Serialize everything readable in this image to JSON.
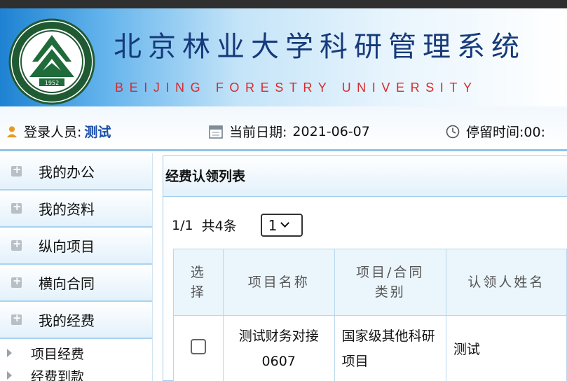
{
  "header": {
    "title": "北京林业大学科研管理系统",
    "subtitle": "BEIJING FORESTRY UNIVERSITY",
    "logo_year": "1952"
  },
  "infobar": {
    "login_label": "登录人员:",
    "login_name": "测试",
    "date_label": "当前日期:",
    "date_value": "2021-06-07",
    "stay_label": "停留时间:00:"
  },
  "sidebar": {
    "menu": [
      {
        "label": "我的办公"
      },
      {
        "label": "我的资料"
      },
      {
        "label": "纵向项目"
      },
      {
        "label": "横向合同"
      },
      {
        "label": "我的经费"
      }
    ],
    "sub_items": [
      {
        "label": "项目经费"
      },
      {
        "label": "经费到款"
      }
    ]
  },
  "main": {
    "panel_title": "经费认领列表",
    "pager": {
      "page_info": "1/1",
      "total": "共4条",
      "selected_page": "1"
    },
    "table": {
      "headers": [
        "选择",
        "项目名称",
        "项目/合同类别",
        "认领人姓名"
      ],
      "rows": [
        {
          "name": "测试财务对接0607",
          "category": "国家级其他科研项目",
          "person": "测试"
        }
      ]
    }
  },
  "colors": {
    "title": "#163a7a",
    "subtitle": "#d92a2a",
    "link": "#1d4fa8",
    "border": "#9fcbeb"
  }
}
